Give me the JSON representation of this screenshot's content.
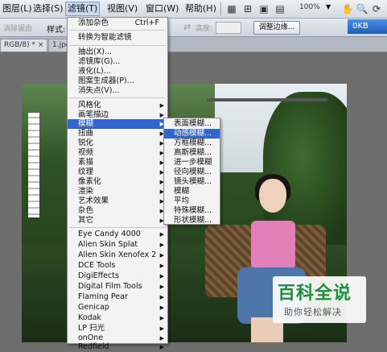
{
  "menubar": {
    "items": [
      {
        "label": "图层(L)"
      },
      {
        "label": "选择(S)"
      },
      {
        "label": "滤镜(T)"
      },
      {
        "label": "视图(V)"
      },
      {
        "label": "窗口(W)"
      },
      {
        "label": "帮助(H)"
      }
    ],
    "zoom": "100%"
  },
  "options": {
    "antialias": "消除锯齿",
    "style_label": "样式:",
    "height_label": "高度:",
    "refine_edge": "调整边缘...",
    "workspace": "0KB"
  },
  "tabs": [
    {
      "label": "RGB/8) * ×"
    },
    {
      "label": "1.jpg"
    }
  ],
  "filter_menu": {
    "items": [
      {
        "label": "添加杂色",
        "shortcut": "Ctrl+F"
      },
      {
        "label": "转换为智能滤镜"
      },
      {
        "label": "抽出(X)..."
      },
      {
        "label": "滤镜库(G)..."
      },
      {
        "label": "液化(L)..."
      },
      {
        "label": "图案生成器(P)..."
      },
      {
        "label": "消失点(V)..."
      },
      {
        "label": "风格化"
      },
      {
        "label": "画笔描边"
      },
      {
        "label": "模糊"
      },
      {
        "label": "扭曲"
      },
      {
        "label": "锐化"
      },
      {
        "label": "视频"
      },
      {
        "label": "素描"
      },
      {
        "label": "纹理"
      },
      {
        "label": "像素化"
      },
      {
        "label": "渲染"
      },
      {
        "label": "艺术效果"
      },
      {
        "label": "杂色"
      },
      {
        "label": "其它"
      },
      {
        "label": "Eye Candy 4000"
      },
      {
        "label": "Alien Skin Splat"
      },
      {
        "label": "Alien Skin Xenofex 2"
      },
      {
        "label": "DCE Tools"
      },
      {
        "label": "DigiEffects"
      },
      {
        "label": "Digital Film Tools"
      },
      {
        "label": "Flaming Pear"
      },
      {
        "label": "Genicap"
      },
      {
        "label": "Kodak"
      },
      {
        "label": "LP 扫光"
      },
      {
        "label": "onOne"
      },
      {
        "label": "Redfield"
      }
    ]
  },
  "blur_submenu": {
    "items": [
      {
        "label": "表面模糊..."
      },
      {
        "label": "动感模糊..."
      },
      {
        "label": "方框模糊..."
      },
      {
        "label": "高斯模糊..."
      },
      {
        "label": "进一步模糊"
      },
      {
        "label": "径向模糊..."
      },
      {
        "label": "镜头模糊..."
      },
      {
        "label": "模糊"
      },
      {
        "label": "平均"
      },
      {
        "label": "特殊模糊..."
      },
      {
        "label": "形状模糊..."
      }
    ]
  },
  "watermark": {
    "title": "百科全说",
    "subtitle": "助你轻松解决"
  },
  "colors": {
    "highlight": "#3366cc",
    "watermark_green": "#1e8e3e"
  }
}
